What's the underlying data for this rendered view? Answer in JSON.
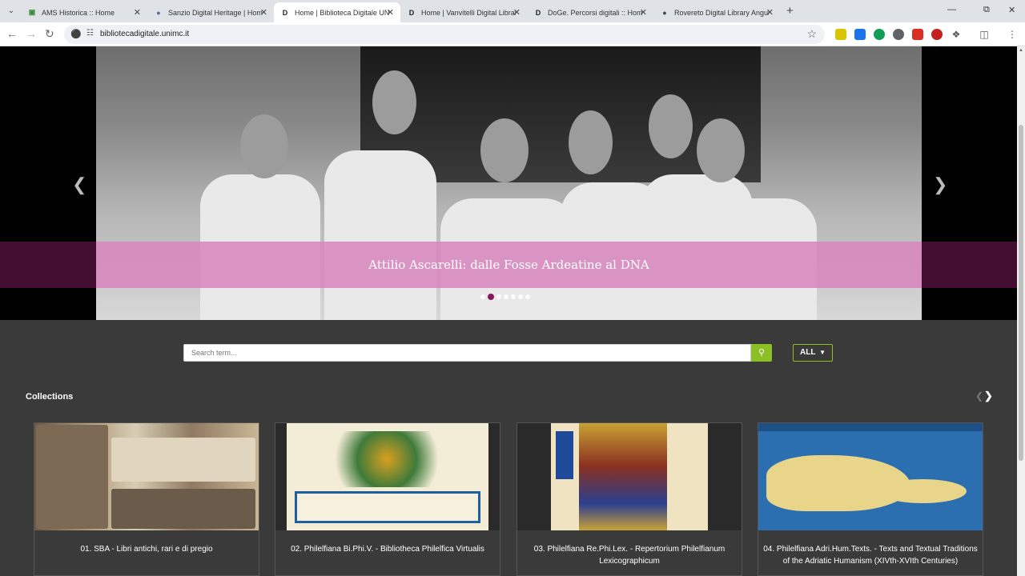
{
  "browser": {
    "tabs": [
      {
        "title": "AMS Historica :: Home",
        "active": false,
        "favicon": "ams-icon"
      },
      {
        "title": "Sanzio Digital Heritage | Home",
        "active": false,
        "favicon": "sanzio-icon"
      },
      {
        "title": "Home | Biblioteca Digitale UNI",
        "active": true,
        "favicon": "d-logo-icon"
      },
      {
        "title": "Home | Vanvitelli Digital Library",
        "active": false,
        "favicon": "d-logo-icon"
      },
      {
        "title": "DoGe. Percorsi digitali :: Home",
        "active": false,
        "favicon": "d-logo-icon"
      },
      {
        "title": "Rovereto Digital Library Angula",
        "active": false,
        "favicon": "globe-icon"
      }
    ],
    "url": "bibliotecadigitale.unimc.it"
  },
  "hero": {
    "caption": "Attilio Ascarelli: dalle Fosse Ardeatine al DNA",
    "slide_count": 7,
    "active_slide": 2
  },
  "search": {
    "placeholder": "Search term...",
    "filter_label": "ALL"
  },
  "collections": {
    "title": "Collections",
    "items": [
      {
        "label": "01. SBA - Libri antichi, rari e di pregio"
      },
      {
        "label": "02. Philelfiana Bi.Phi.V. - Bibliotheca Philelfica Virtualis"
      },
      {
        "label": "03. Philelfiana Re.Phi.Lex. - Repertorium Philelfianum Lexicographicum"
      },
      {
        "label": "04. Philelfiana Adri.Hum.Texts. - Texts and Textual Traditions of the Adriatic Humanism (XIVth-XVIth Centuries)"
      }
    ]
  },
  "colors": {
    "accent": "#8cbf26",
    "caption_band": "#e196c8",
    "active_dot": "#8a1560",
    "page_bg": "#3a3a3a"
  }
}
